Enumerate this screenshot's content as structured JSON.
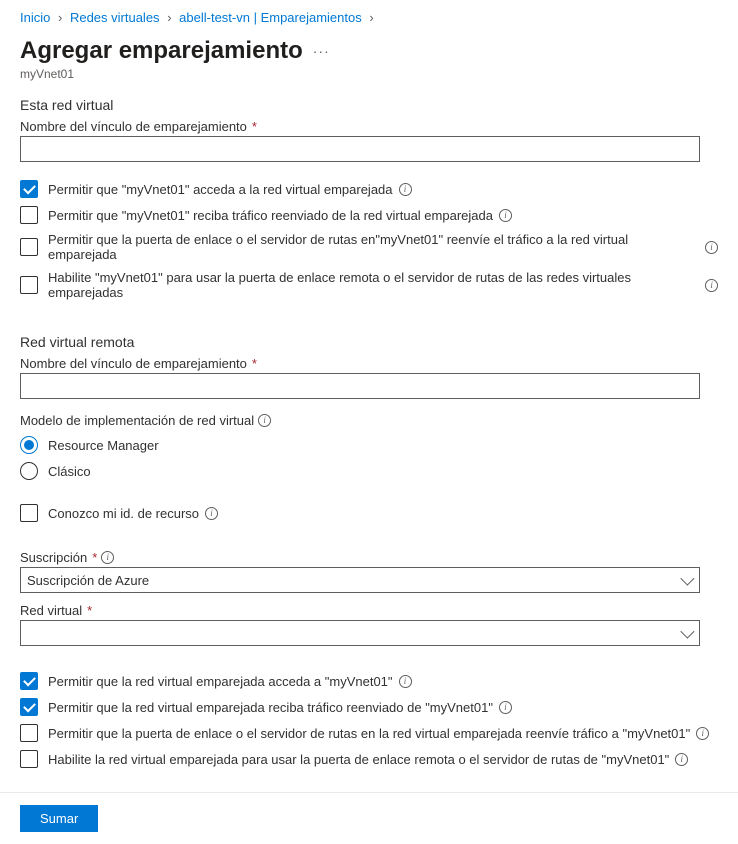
{
  "breadcrumb": {
    "home": "Inicio",
    "vnets": "Redes virtuales",
    "resource": "abell-test-vn | Emparejamientos"
  },
  "page": {
    "title": "Agregar emparejamiento",
    "subtitle": "myVnet01"
  },
  "thisVnet": {
    "heading": "Esta red virtual",
    "linkNameLabel": "Nombre del vínculo de emparejamiento",
    "linkNameValue": "",
    "permissions": [
      {
        "label": "Permitir que \"myVnet01\" acceda a la red virtual emparejada",
        "checked": true,
        "info": true,
        "name": "allow-access-to-remote"
      },
      {
        "label": "Permitir que \"myVnet01\" reciba tráfico reenviado de la red virtual emparejada",
        "checked": false,
        "info": true,
        "name": "allow-forwarded-from-remote"
      },
      {
        "label": "Permitir que la puerta de enlace o el servidor de rutas en\"myVnet01\" reenvíe el tráfico a la red virtual emparejada",
        "checked": false,
        "info": true,
        "name": "allow-gateway-transit-to-remote"
      },
      {
        "label": "Habilite \"myVnet01\" para usar la puerta de enlace remota o el servidor de rutas de las redes virtuales emparejadas",
        "checked": false,
        "info": true,
        "name": "use-remote-gateway"
      }
    ]
  },
  "remoteVnet": {
    "heading": "Red virtual remota",
    "linkNameLabel": "Nombre del vínculo de emparejamiento",
    "linkNameValue": "",
    "deploymentModelLabel": "Modelo de implementación de red virtual",
    "deploymentOptions": [
      {
        "label": "Resource Manager",
        "selected": true,
        "name": "deployment-resource-manager"
      },
      {
        "label": "Clásico",
        "selected": false,
        "name": "deployment-classic"
      }
    ],
    "knowResourceId": {
      "label": "Conozco mi id. de recurso",
      "checked": false,
      "name": "know-resource-id"
    },
    "subscriptionLabel": "Suscripción",
    "subscriptionValue": "Suscripción de Azure",
    "vnetLabel": "Red virtual",
    "vnetValue": "",
    "permissions": [
      {
        "label": "Permitir que la red virtual emparejada acceda a \"myVnet01\"",
        "checked": true,
        "info": true,
        "name": "remote-allow-access-to-local"
      },
      {
        "label": "Permitir que la red virtual emparejada reciba tráfico reenviado de \"myVnet01\"",
        "checked": true,
        "info": true,
        "name": "remote-allow-forwarded-from-local"
      },
      {
        "label": "Permitir que la puerta de enlace o el servidor de rutas en la red virtual emparejada reenvíe tráfico a \"myVnet01\"",
        "checked": false,
        "info": true,
        "name": "remote-allow-gateway-transit-to-local"
      },
      {
        "label": "Habilite la red virtual emparejada para usar la puerta de enlace remota o el servidor de rutas de \"myVnet01\"",
        "checked": false,
        "info": true,
        "name": "remote-use-local-gateway"
      }
    ]
  },
  "footer": {
    "addButton": "Sumar"
  }
}
